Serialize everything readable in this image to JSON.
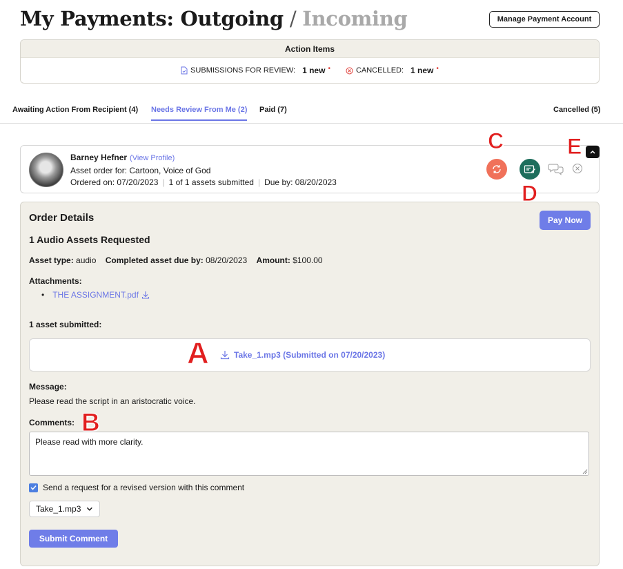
{
  "header": {
    "title_main": "My Payments: Outgoing",
    "title_sep": " / ",
    "title_alt": "Incoming",
    "manage_label": "Manage Payment Account"
  },
  "action_items": {
    "title": "Action Items",
    "submissions_label": "SUBMISSIONS FOR REVIEW:",
    "submissions_count": "1 new",
    "cancelled_label": "CANCELLED:",
    "cancelled_count": "1 new",
    "dot": "•"
  },
  "tabs": [
    {
      "label": "Awaiting Action From Recipient (4)",
      "active": false
    },
    {
      "label": "Needs Review From Me (2)",
      "active": true
    },
    {
      "label": "Paid (7)",
      "active": false
    },
    {
      "label": "Cancelled (5)",
      "active": false
    }
  ],
  "order_card": {
    "name": "Barney Hefner",
    "view_profile": "(View Profile)",
    "asset_order": "Asset order for: Cartoon, Voice of God",
    "ordered_on": "Ordered on: 07/20/2023",
    "assets_submitted": "1 of 1 assets submitted",
    "due_by": "Due by: 08/20/2023",
    "separator": "|"
  },
  "annotations": {
    "a": "A",
    "b": "B",
    "c": "C",
    "d": "D",
    "e": "E"
  },
  "details": {
    "heading": "Order Details",
    "pay_now": "Pay Now",
    "requested": "1 Audio Assets Requested",
    "asset_type_label": "Asset type:",
    "asset_type_value": "audio",
    "due_label": "Completed asset due by:",
    "due_value": "08/20/2023",
    "amount_label": "Amount:",
    "amount_value": "$100.00",
    "attachments_label": "Attachments:",
    "attachment_file": "THE ASSIGNMENT.pdf",
    "bullet": "•",
    "submitted_label": "1 asset submitted:",
    "asset_link": "Take_1.mp3 (Submitted on 07/20/2023)",
    "message_label": "Message:",
    "message_text": "Please read the script in an aristocratic voice.",
    "comments_label": "Comments:",
    "comment_value": "Please read with more clarity.",
    "checkbox_label": "Send a request for a revised version with this comment",
    "select_value": "Take_1.mp3",
    "submit_label": "Submit Comment"
  },
  "colors": {
    "accent": "#6b76e6",
    "button": "#6f7de8",
    "refresh": "#f0715a",
    "payment": "#1e6e5c",
    "annotation": "#e11f1f",
    "panel": "#f1efe8"
  }
}
